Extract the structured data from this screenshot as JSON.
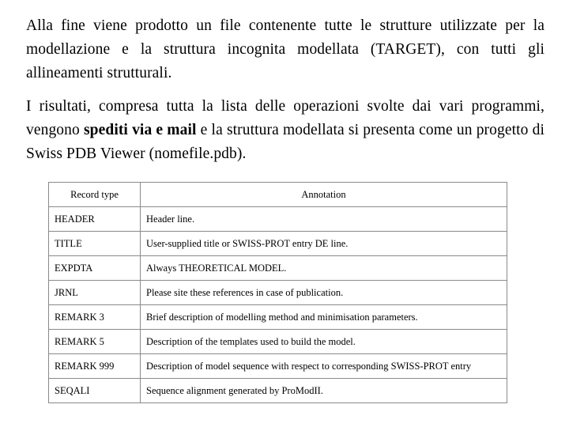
{
  "slide": {
    "paragraphs": [
      {
        "id": "para-1",
        "runs": [
          {
            "text": "Alla fine viene prodotto un file contenente tutte le strutture utilizzate per la modellazione e la struttura incognita modellata (TARGET), con tutti gli allineamenti strutturali.",
            "bold": false
          }
        ]
      },
      {
        "id": "para-2",
        "runs": [
          {
            "text": "I risultati, compresa tutta la lista delle operazioni svolte dai vari programmi, vengono ",
            "bold": false
          },
          {
            "text": "spediti via e mail",
            "bold": true
          },
          {
            "text": " e la struttura modellata si presenta come un progetto di Swiss PDB Viewer (nomefile.pdb).",
            "bold": false
          }
        ]
      }
    ],
    "table": {
      "headers": [
        "Record type",
        "Annotation"
      ],
      "rows": [
        {
          "type": "HEADER",
          "annotation": "Header line."
        },
        {
          "type": "TITLE",
          "annotation": "User-supplied title or SWISS-PROT entry DE line."
        },
        {
          "type": "EXPDTA",
          "annotation": "Always THEORETICAL MODEL."
        },
        {
          "type": "JRNL",
          "annotation": "Please site these references in case of publication."
        },
        {
          "type": "REMARK 3",
          "annotation": "Brief description of modelling method and minimisation parameters."
        },
        {
          "type": "REMARK 5",
          "annotation": "Description of the templates used to build the model."
        },
        {
          "type": "REMARK 999",
          "annotation": "Description of model sequence with respect to corresponding SWISS-PROT entry"
        },
        {
          "type": "SEQALI",
          "annotation": "Sequence alignment generated by ProModII."
        }
      ]
    }
  }
}
